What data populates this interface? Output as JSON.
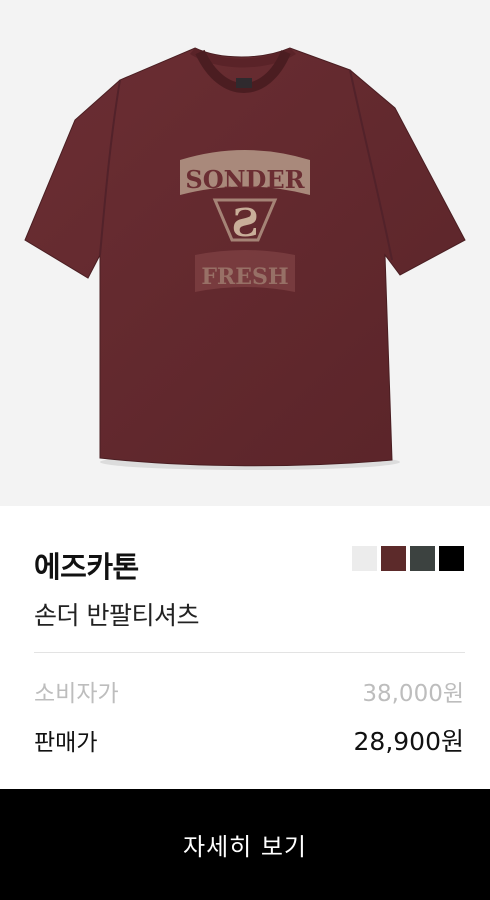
{
  "product": {
    "brand": "에즈카톤",
    "name": "손더 반팔티셔츠",
    "image_alt": "burgundy oversized t-shirt",
    "graphic_text_top": "SONDER",
    "graphic_text_bottom": "FRESH",
    "color_options": [
      "#ececec",
      "#5c2a2a",
      "#3c4240",
      "#000000"
    ]
  },
  "pricing": {
    "retail_label": "소비자가",
    "retail_value": "38,000원",
    "sale_label": "판매가",
    "sale_value": "28,900원"
  },
  "actions": {
    "detail_label": "자세히 보기"
  }
}
